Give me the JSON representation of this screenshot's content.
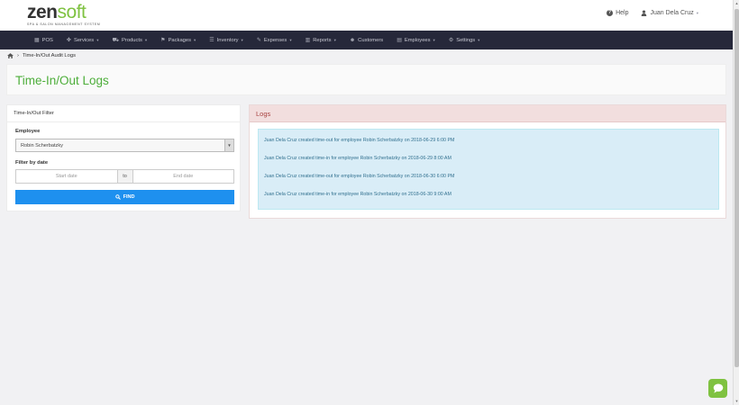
{
  "brand": {
    "name_a": "zen",
    "name_b": "soft",
    "tagline": "SPA & SALON MANAGEMENT SYSTEM",
    "accent_color": "#7fc241"
  },
  "header": {
    "help_label": "Help",
    "user_label": "Juan Dela Cruz"
  },
  "nav": {
    "pos": "POS",
    "services": "Services",
    "products": "Products",
    "packages": "Packages",
    "inventory": "Inventory",
    "expenses": "Expenses",
    "reports": "Reports",
    "customers": "Customers",
    "employees": "Employees",
    "settings": "Settings"
  },
  "breadcrumb": {
    "current": "Time-In/Out Audit Logs"
  },
  "page": {
    "title": "Time-In/Out Logs"
  },
  "filter": {
    "panel_title": "Time-In/Out Filter",
    "employee_label": "Employee",
    "employee_value": "Robin Scherbatzky",
    "date_label": "Filter by date",
    "start_placeholder": "Start date",
    "to_label": "to",
    "end_placeholder": "End date",
    "find_label": "FIND"
  },
  "logs": {
    "panel_title": "Logs",
    "entries": [
      "Juan Dela Cruz created time-out for employee Robin Scherbatzky on 2018-06-29 6:00 PM",
      "Juan Dela Cruz created time-in for employee Robin Scherbatzky on 2018-06-29 8:00 AM",
      "Juan Dela Cruz created time-out for employee Robin Scherbatzky on 2018-06-30 6:00 PM",
      "Juan Dela Cruz created time-in for employee Robin Scherbatzky on 2018-06-30 9:00 AM"
    ]
  }
}
